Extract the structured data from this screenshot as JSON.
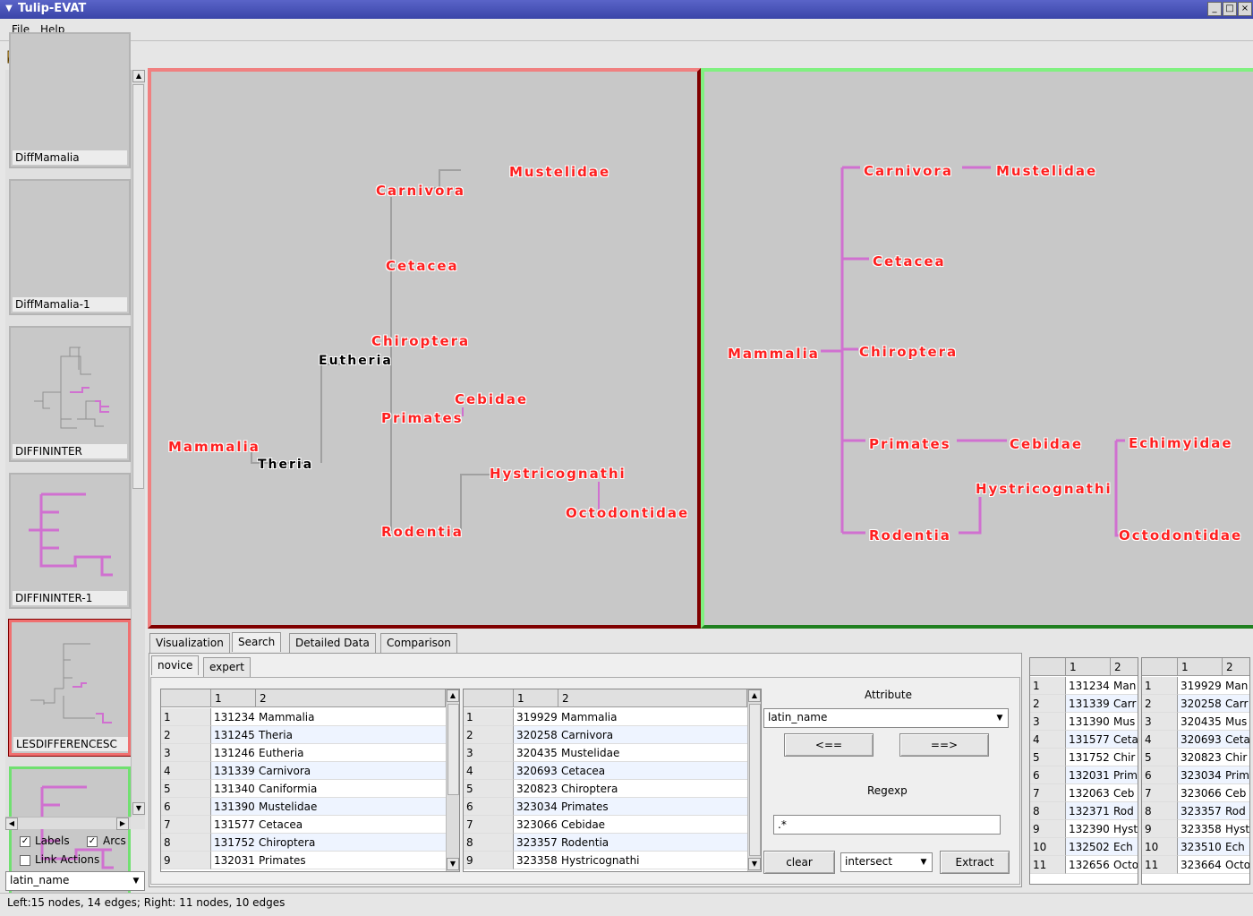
{
  "window": {
    "title": "Tulip-EVAT"
  },
  "menu": {
    "file": "File",
    "help": "Help"
  },
  "side": {
    "thumbs": [
      {
        "label": "DiffMamalia"
      },
      {
        "label": "DiffMamalia-1"
      },
      {
        "label": "DIFFININTER"
      },
      {
        "label": "DIFFININTER-1"
      },
      {
        "label": "LESDIFFERENCESC"
      },
      {
        "label": ""
      }
    ],
    "labels_check": "Labels",
    "arcs_check": "Arcs",
    "link_actions": "Link Actions",
    "attribute_combo": "latin_name"
  },
  "left_view": {
    "nodes": {
      "mustelidae": "Mustelidae",
      "carnivora": "Carnivora",
      "cetacea": "Cetacea",
      "chiroptera": "Chiroptera",
      "eutheria": "Eutheria",
      "cebidae": "Cebidae",
      "primates": "Primates",
      "mammalia": "Mammalia",
      "theria": "Theria",
      "hystricognathi": "Hystricognathi",
      "octodontidae": "Octodontidae",
      "rodentia": "Rodentia"
    }
  },
  "right_view": {
    "nodes": {
      "carnivora": "Carnivora",
      "mustelidae": "Mustelidae",
      "cetacea": "Cetacea",
      "mammalia": "Mammalia",
      "chiroptera": "Chiroptera",
      "primates": "Primates",
      "cebidae": "Cebidae",
      "echimyidae": "Echimyidae",
      "hystricognathi": "Hystricognathi",
      "rodentia": "Rodentia",
      "octodontidae": "Octodontidae"
    }
  },
  "tabs": {
    "visualization": "Visualization",
    "search": "Search",
    "detailed": "Detailed Data",
    "comparison": "Comparison"
  },
  "subtabs": {
    "novice": "novice",
    "expert": "expert"
  },
  "search_table_left": {
    "headers": [
      "1",
      "2"
    ],
    "rows": [
      [
        "1",
        "131234",
        "Mammalia"
      ],
      [
        "2",
        "131245",
        "Theria"
      ],
      [
        "3",
        "131246",
        "Eutheria"
      ],
      [
        "4",
        "131339",
        "Carnivora"
      ],
      [
        "5",
        "131340",
        "Caniformia"
      ],
      [
        "6",
        "131390",
        "Mustelidae"
      ],
      [
        "7",
        "131577",
        "Cetacea"
      ],
      [
        "8",
        "131752",
        "Chiroptera"
      ],
      [
        "9",
        "132031",
        "Primates"
      ]
    ]
  },
  "search_table_right": {
    "headers": [
      "1",
      "2"
    ],
    "rows": [
      [
        "1",
        "319929",
        "Mammalia"
      ],
      [
        "2",
        "320258",
        "Carnivora"
      ],
      [
        "3",
        "320435",
        "Mustelidae"
      ],
      [
        "4",
        "320693",
        "Cetacea"
      ],
      [
        "5",
        "320823",
        "Chiroptera"
      ],
      [
        "6",
        "323034",
        "Primates"
      ],
      [
        "7",
        "323066",
        "Cebidae"
      ],
      [
        "8",
        "323357",
        "Rodentia"
      ],
      [
        "9",
        "323358",
        "Hystricognathi"
      ]
    ]
  },
  "controls": {
    "attribute_label": "Attribute",
    "attribute_value": "latin_name",
    "left_btn": "<==",
    "right_btn": "==>",
    "regexp_label": "Regexp",
    "regexp_value": ".*",
    "clear": "clear",
    "op": "intersect",
    "extract": "Extract"
  },
  "result_table_left": {
    "headers": [
      "1",
      "2"
    ],
    "rows": [
      [
        "1",
        "131234",
        "Man"
      ],
      [
        "2",
        "131339",
        "Carr"
      ],
      [
        "3",
        "131390",
        "Mus"
      ],
      [
        "4",
        "131577",
        "Ceta"
      ],
      [
        "5",
        "131752",
        "Chir"
      ],
      [
        "6",
        "132031",
        "Prim"
      ],
      [
        "7",
        "132063",
        "Ceb"
      ],
      [
        "8",
        "132371",
        "Rod"
      ],
      [
        "9",
        "132390",
        "Hyst"
      ],
      [
        "10",
        "132502",
        "Ech"
      ],
      [
        "11",
        "132656",
        "Octo"
      ]
    ]
  },
  "result_table_right": {
    "headers": [
      "1",
      "2"
    ],
    "rows": [
      [
        "1",
        "319929",
        "Man"
      ],
      [
        "2",
        "320258",
        "Carr"
      ],
      [
        "3",
        "320435",
        "Mus"
      ],
      [
        "4",
        "320693",
        "Ceta"
      ],
      [
        "5",
        "320823",
        "Chir"
      ],
      [
        "6",
        "323034",
        "Prim"
      ],
      [
        "7",
        "323066",
        "Ceb"
      ],
      [
        "8",
        "323357",
        "Rod"
      ],
      [
        "9",
        "323358",
        "Hyst"
      ],
      [
        "10",
        "323510",
        "Ech"
      ],
      [
        "11",
        "323664",
        "Octo"
      ]
    ]
  },
  "status": "Left:15 nodes, 14 edges; Right: 11 nodes, 10 edges",
  "colors": {
    "left_border": "#f08080",
    "left_border_dark": "#800000",
    "right_border": "#80f080",
    "edge_magenta": "#d070d0",
    "edge_gray": "#a0a0a0",
    "node_red": "#ff2020"
  }
}
